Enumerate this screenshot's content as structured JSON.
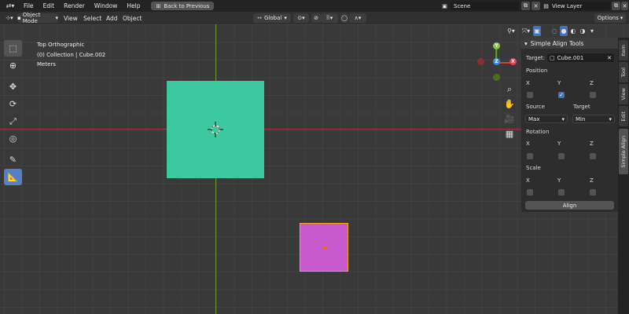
{
  "topbar": {
    "menus": [
      "File",
      "Edit",
      "Render",
      "Window",
      "Help"
    ],
    "back_label": "Back to Previous",
    "scene": "Scene",
    "view_layer": "View Layer"
  },
  "header": {
    "mode": "Object Mode",
    "menus": [
      "View",
      "Select",
      "Add",
      "Object"
    ],
    "orientation": "Global",
    "options": "Options"
  },
  "overlay": {
    "view": "Top Orthographic",
    "collection": "(0) Collection | Cube.002",
    "units": "Meters"
  },
  "gizmo": {
    "x": "X",
    "y": "Y",
    "z": "Z"
  },
  "panel": {
    "title": "Simple Align Tools",
    "target_label": "Target:",
    "target_value": "Cube.001",
    "position_label": "Position",
    "position_axes": [
      "X",
      "Y",
      "Z"
    ],
    "position_checked": [
      false,
      true,
      false
    ],
    "source_label": "Source",
    "target_col_label": "Target",
    "source_value": "Max",
    "target_select_value": "Min",
    "rotation_label": "Rotation",
    "rotation_axes": [
      "X",
      "Y",
      "Z"
    ],
    "scale_label": "Scale",
    "scale_axes": [
      "X",
      "Y",
      "Z"
    ],
    "align_button": "Align"
  },
  "side_tabs": [
    "Item",
    "Tool",
    "View",
    "Edit",
    "Simple Align"
  ],
  "colors": {
    "cube_active": "#3cc9a0",
    "cube_target": "#c95acb",
    "selection_outline": "#f5a623",
    "x_axis": "#9a3b44",
    "y_axis": "#6a9a2e"
  }
}
